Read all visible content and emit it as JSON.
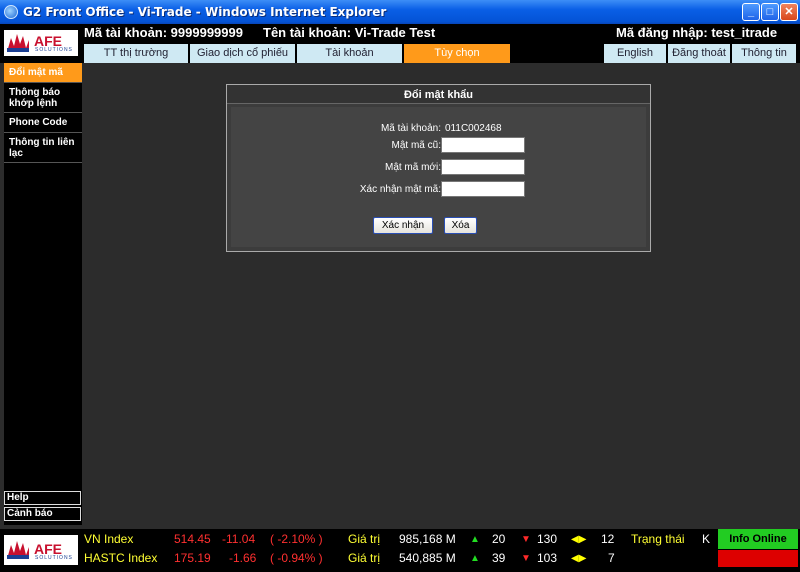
{
  "window": {
    "title": "G2 Front Office - Vi-Trade - Windows Internet Explorer"
  },
  "logo": {
    "brand": "AFE",
    "sub": "SOLUTIONS"
  },
  "header": {
    "account_label": "Mã tài khoản: 9999999999",
    "account_name": "Tên tài khoản: Vi-Trade Test",
    "login_id": "Mã đăng nhập: test_itrade"
  },
  "tabs": {
    "market": "TT thị trường",
    "stock_trading": "Giao dịch cổ phiếu",
    "account": "Tài khoản",
    "options": "Tùy chọn",
    "english": "English",
    "logout": "Đăng thoát",
    "info": "Thông tin"
  },
  "sidebar": {
    "items": [
      {
        "label": "Đổi mật mã"
      },
      {
        "label": "Thông báo khớp lệnh"
      },
      {
        "label": "Phone Code"
      },
      {
        "label": "Thông tin liên lạc"
      }
    ],
    "help": "Help",
    "alert": "Cảnh báo"
  },
  "dialog": {
    "title": "Đổi mật khẩu",
    "account_label": "Mã tài khoản:",
    "account_value": "011C002468",
    "old_password_label": "Mật mã cũ:",
    "new_password_label": "Mật mã mới:",
    "confirm_password_label": "Xác nhận mật mã:",
    "confirm_button": "Xác nhận",
    "clear_button": "Xóa"
  },
  "ticker": {
    "rows": [
      {
        "index": "VN Index",
        "value": "514.45",
        "change": "-11.04",
        "pct": "( -2.10% )",
        "label": "Giá trị",
        "amount": "985,168 M",
        "up": "20",
        "down": "130",
        "flat": "12"
      },
      {
        "index": "HASTC Index",
        "value": "175.19",
        "change": "-1.66",
        "pct": "( -0.94% )",
        "label": "Giá trị",
        "amount": "540,885 M",
        "up": "39",
        "down": "103",
        "flat": "7"
      }
    ],
    "status_label": "Trạng thái",
    "status_value": "K",
    "online": "Info Online"
  },
  "colors": {
    "accent": "#ff9a1a",
    "tab": "#cfe9f3",
    "up": "#22dd22",
    "down": "#ff2a2a",
    "online": "#22cc22"
  }
}
